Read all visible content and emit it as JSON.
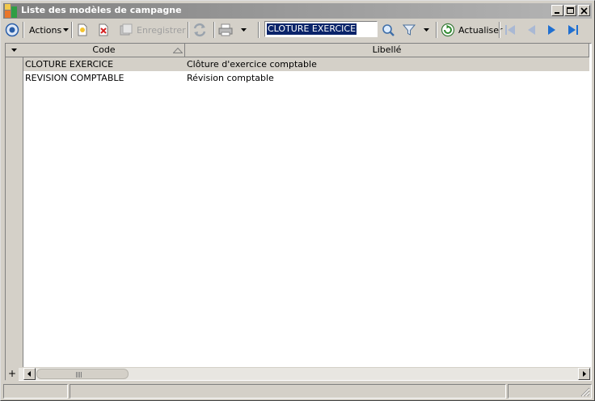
{
  "window": {
    "title": "Liste des modèles de campagne"
  },
  "toolbar": {
    "actions_label": "Actions",
    "save_label": "Enregistrer",
    "search_value": "CLOTURE EXERCICE",
    "refresh_label": "Actualiser"
  },
  "grid": {
    "columns": [
      {
        "label": "Code",
        "sort": "ascending"
      },
      {
        "label": "Libellé"
      }
    ],
    "rows": [
      {
        "code": "CLOTURE EXERCICE",
        "libelle": "Clôture d'exercice comptable",
        "selected": true
      },
      {
        "code": "REVISION COMPTABLE",
        "libelle": "Révision comptable",
        "selected": false
      }
    ]
  },
  "scrollbar": {
    "plus_label": "+"
  },
  "icons": {
    "app": "app-chart-icon",
    "menu": "circle-menu-icon",
    "new": "new-document-icon",
    "delete": "delete-icon",
    "save": "save-icon",
    "sync": "sync-icon",
    "print": "printer-icon",
    "search": "magnifier-icon",
    "filter": "filter-icon",
    "refresh": "refresh-icon",
    "first": "first-record-icon",
    "prev": "previous-record-icon",
    "next": "next-record-icon",
    "last": "last-record-icon"
  },
  "colors": {
    "title_gradient_start": "#808080",
    "title_gradient_end": "#b5b5b5",
    "selection": "#0a246a",
    "nav_active": "#1f6fd1",
    "nav_disabled": "#a9b8d4"
  }
}
